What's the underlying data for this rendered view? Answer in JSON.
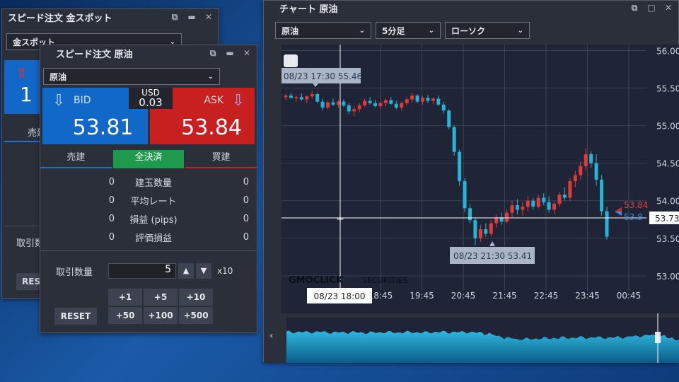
{
  "gold_window": {
    "title": "スピード注文 金スポット",
    "product": "金スポット",
    "bid_price_partial": "1",
    "tab_sell_partial": "売建",
    "trade_qty_partial": "取引数",
    "reset_partial": "RES"
  },
  "oil_window": {
    "title": "スピード注文 原油",
    "product": "原油",
    "bid_label": "BID",
    "ask_label": "ASK",
    "bid_price": "53.81",
    "ask_price": "53.84",
    "spread_currency": "USD",
    "spread_value": "0.03",
    "tabs": {
      "sell": "売建",
      "close_all": "全決済",
      "buy": "買建"
    },
    "stats": [
      {
        "left": "0",
        "label": "建玉数量",
        "right": "0"
      },
      {
        "left": "0",
        "label": "平均レート",
        "right": "0"
      },
      {
        "left": "0",
        "label": "損益 (pips)",
        "right": "0"
      },
      {
        "left": "0",
        "label": "評価損益",
        "right": "0"
      }
    ],
    "qty_label": "取引数量",
    "qty_value": "5",
    "multiplier": "x10",
    "qty_buttons": [
      "+1",
      "+5",
      "+10",
      "+50",
      "+100",
      "+500"
    ],
    "reset_label": "RESET"
  },
  "chart_window": {
    "title": "チャート 原油",
    "product_select": "原油",
    "interval_select": "5分足",
    "type_select": "ローソク",
    "watermark_brand": "GMOCLICK",
    "watermark_suffix": "SECURITIES",
    "tooltip_high": "08/23 17:30 55.46",
    "tooltip_low": "08/23 21:30 53.41",
    "crosshair_time": "08/23 18:00",
    "crosshair_price": "53.73",
    "ask_marker": "53.84",
    "bid_marker": "53.8"
  },
  "chart_data": {
    "type": "candlestick",
    "x_ticks": [
      "18:45",
      "19:45",
      "20:45",
      "21:45",
      "22:45",
      "23:45",
      "00:45"
    ],
    "y_ticks": [
      "56.00",
      "55.50",
      "55.00",
      "54.50",
      "54.00",
      "53.50",
      "53.00"
    ],
    "ylim": [
      52.97,
      56.08
    ],
    "candles": [
      [
        55.38,
        55.42,
        55.34,
        55.4
      ],
      [
        55.4,
        55.44,
        55.36,
        55.37
      ],
      [
        55.37,
        55.4,
        55.32,
        55.38
      ],
      [
        55.38,
        55.43,
        55.33,
        55.35
      ],
      [
        55.35,
        55.4,
        55.3,
        55.39
      ],
      [
        55.39,
        55.46,
        55.36,
        55.42
      ],
      [
        55.42,
        55.44,
        55.3,
        55.32
      ],
      [
        55.32,
        55.36,
        55.2,
        55.24
      ],
      [
        55.24,
        55.33,
        55.22,
        55.31
      ],
      [
        55.31,
        55.36,
        55.26,
        55.28
      ],
      [
        55.28,
        55.34,
        55.24,
        55.32
      ],
      [
        55.32,
        55.35,
        55.25,
        55.27
      ],
      [
        55.27,
        55.3,
        55.15,
        55.19
      ],
      [
        55.19,
        55.26,
        55.12,
        55.22
      ],
      [
        55.22,
        55.3,
        55.18,
        55.27
      ],
      [
        55.27,
        55.36,
        55.25,
        55.33
      ],
      [
        55.33,
        55.38,
        55.28,
        55.3
      ],
      [
        55.3,
        55.34,
        55.24,
        55.26
      ],
      [
        55.26,
        55.32,
        55.22,
        55.3
      ],
      [
        55.3,
        55.36,
        55.26,
        55.34
      ],
      [
        55.34,
        55.38,
        55.28,
        55.29
      ],
      [
        55.29,
        55.33,
        55.22,
        55.24
      ],
      [
        55.24,
        55.32,
        55.2,
        55.3
      ],
      [
        55.3,
        55.38,
        55.27,
        55.35
      ],
      [
        55.35,
        55.44,
        55.31,
        55.4
      ],
      [
        55.4,
        55.42,
        55.3,
        55.32
      ],
      [
        55.32,
        55.4,
        55.28,
        55.37
      ],
      [
        55.37,
        55.41,
        55.3,
        55.33
      ],
      [
        55.33,
        55.38,
        55.29,
        55.36
      ],
      [
        55.36,
        55.4,
        55.26,
        55.28
      ],
      [
        55.28,
        55.32,
        55.16,
        55.2
      ],
      [
        55.2,
        55.22,
        54.95,
        54.98
      ],
      [
        54.98,
        55.0,
        54.6,
        54.65
      ],
      [
        54.65,
        54.68,
        54.2,
        54.26
      ],
      [
        54.26,
        54.3,
        53.85,
        53.9
      ],
      [
        53.9,
        53.95,
        53.7,
        53.74
      ],
      [
        53.74,
        53.78,
        53.41,
        53.5
      ],
      [
        53.5,
        53.68,
        53.45,
        53.62
      ],
      [
        53.62,
        53.7,
        53.52,
        53.56
      ],
      [
        53.56,
        53.74,
        53.52,
        53.7
      ],
      [
        53.7,
        53.82,
        53.64,
        53.78
      ],
      [
        53.78,
        53.84,
        53.68,
        53.72
      ],
      [
        53.72,
        53.88,
        53.7,
        53.84
      ],
      [
        53.84,
        54.0,
        53.78,
        53.94
      ],
      [
        53.94,
        54.02,
        53.82,
        53.88
      ],
      [
        53.88,
        53.98,
        53.8,
        53.92
      ],
      [
        53.92,
        54.06,
        53.86,
        54.0
      ],
      [
        54.0,
        54.04,
        53.88,
        53.92
      ],
      [
        53.92,
        54.08,
        53.9,
        54.04
      ],
      [
        54.04,
        54.1,
        53.94,
        53.98
      ],
      [
        53.98,
        54.06,
        53.84,
        53.88
      ],
      [
        53.88,
        54.0,
        53.82,
        53.96
      ],
      [
        53.96,
        54.12,
        53.92,
        54.08
      ],
      [
        54.08,
        54.18,
        54.0,
        54.04
      ],
      [
        54.04,
        54.3,
        54.0,
        54.26
      ],
      [
        54.26,
        54.4,
        54.18,
        54.34
      ],
      [
        54.34,
        54.52,
        54.28,
        54.46
      ],
      [
        54.46,
        54.7,
        54.4,
        54.62
      ],
      [
        54.62,
        54.66,
        54.44,
        54.5
      ],
      [
        54.5,
        54.62,
        54.2,
        54.28
      ],
      [
        54.28,
        54.34,
        53.8,
        53.86
      ],
      [
        53.86,
        53.92,
        53.48,
        53.52
      ]
    ]
  }
}
